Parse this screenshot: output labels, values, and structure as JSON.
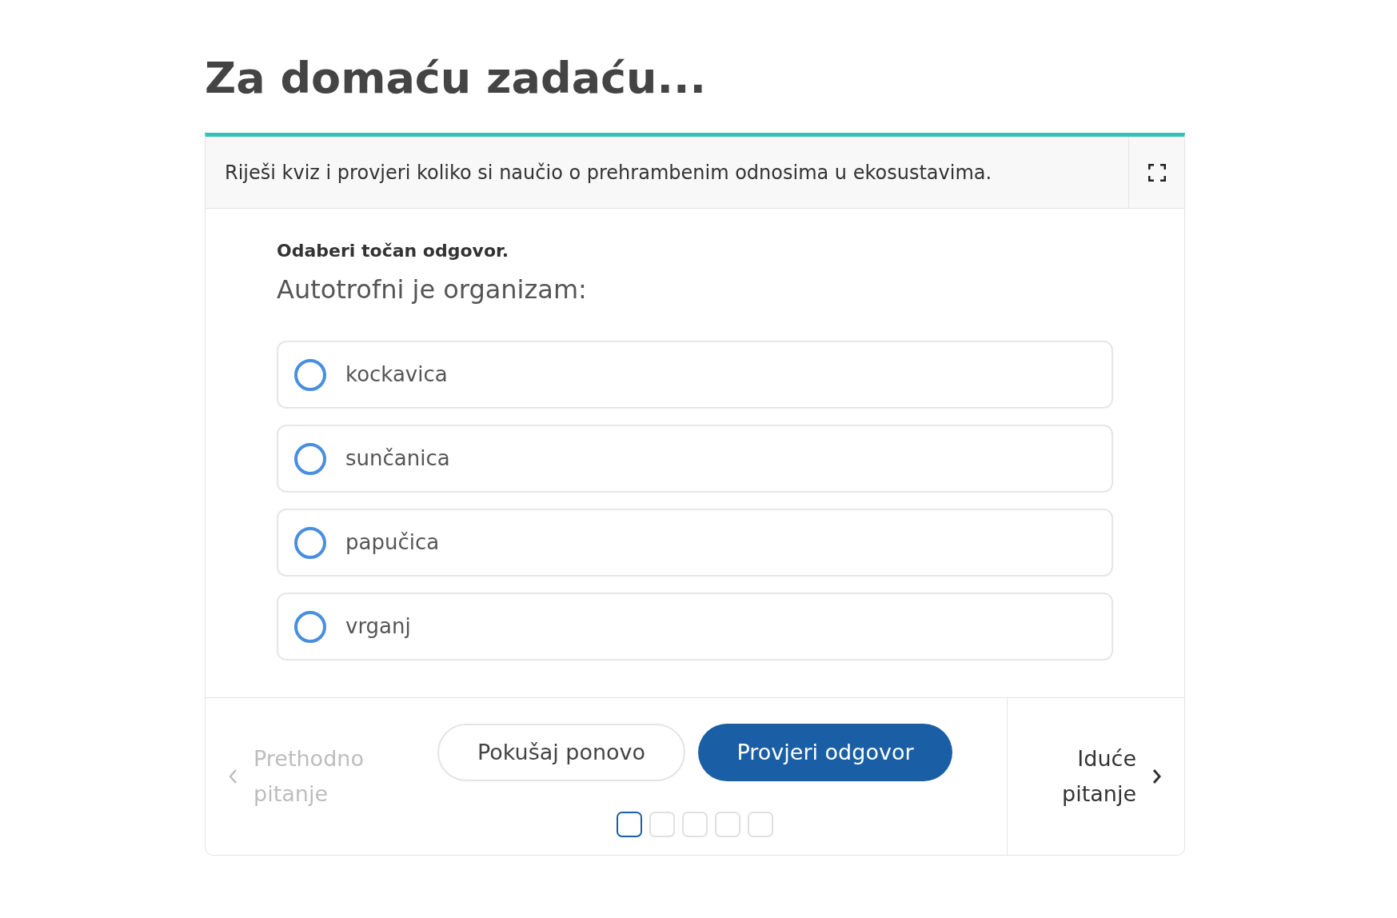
{
  "heading": "Za domaću zadaću...",
  "card": {
    "intro": "Riješi kviz i provjeri koliko si naučio o prehrambenim odnosima u ekosustavima.",
    "instruction": "Odaberi točan odgovor.",
    "question": "Autotrofni je organizam:",
    "options": [
      {
        "label": "kockavica",
        "selected": false
      },
      {
        "label": "sunčanica",
        "selected": false
      },
      {
        "label": "papučica",
        "selected": false
      },
      {
        "label": "vrganj",
        "selected": false
      }
    ],
    "previous": {
      "lines": [
        "Prethodno",
        "pitanje"
      ],
      "disabled": true
    },
    "retry_button": "Pokušaj ponovo",
    "check_button": "Provjeri odgovor",
    "progress": [
      {
        "selected": true
      },
      {
        "selected": false
      },
      {
        "selected": false
      },
      {
        "selected": false
      },
      {
        "selected": false
      }
    ],
    "next": {
      "lines": [
        "Iduće",
        "pitanje"
      ],
      "disabled": false
    }
  }
}
